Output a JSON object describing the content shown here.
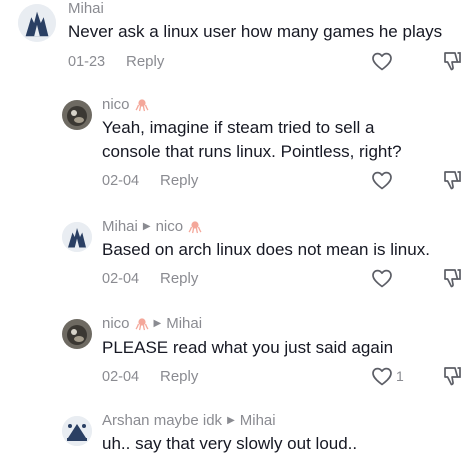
{
  "comments": [
    {
      "author": "Mihai",
      "reply_to": "",
      "text": "Never ask a linux user how many games he plays",
      "date": "01-23",
      "reply_label": "Reply",
      "like_count": "",
      "avatar_icon": "wolf-avatar"
    },
    {
      "author": "nico",
      "reply_to": "",
      "text": "Yeah, imagine if steam tried to sell a console that runs linux. Pointless, right?",
      "date": "02-04",
      "reply_label": "Reply",
      "like_count": "",
      "avatar_icon": "cat-photo-avatar"
    },
    {
      "author": "Mihai",
      "reply_to": "nico",
      "text": "Based on arch linux does not mean is linux.",
      "date": "02-04",
      "reply_label": "Reply",
      "like_count": "",
      "avatar_icon": "wolf-avatar"
    },
    {
      "author": "nico",
      "reply_to": "Mihai",
      "text": "PLEASE read what you just said again",
      "date": "02-04",
      "reply_label": "Reply",
      "like_count": "1",
      "avatar_icon": "cat-photo-avatar"
    },
    {
      "author": "Arshan maybe idk",
      "reply_to": "Mihai",
      "text": "uh.. say that very slowly out loud..",
      "date": "",
      "reply_label": "",
      "like_count": "",
      "avatar_icon": "landmark-avatar"
    }
  ],
  "colors": {
    "text": "#161823",
    "muted": "#8a8b91",
    "octopus": "#f4a79a"
  }
}
